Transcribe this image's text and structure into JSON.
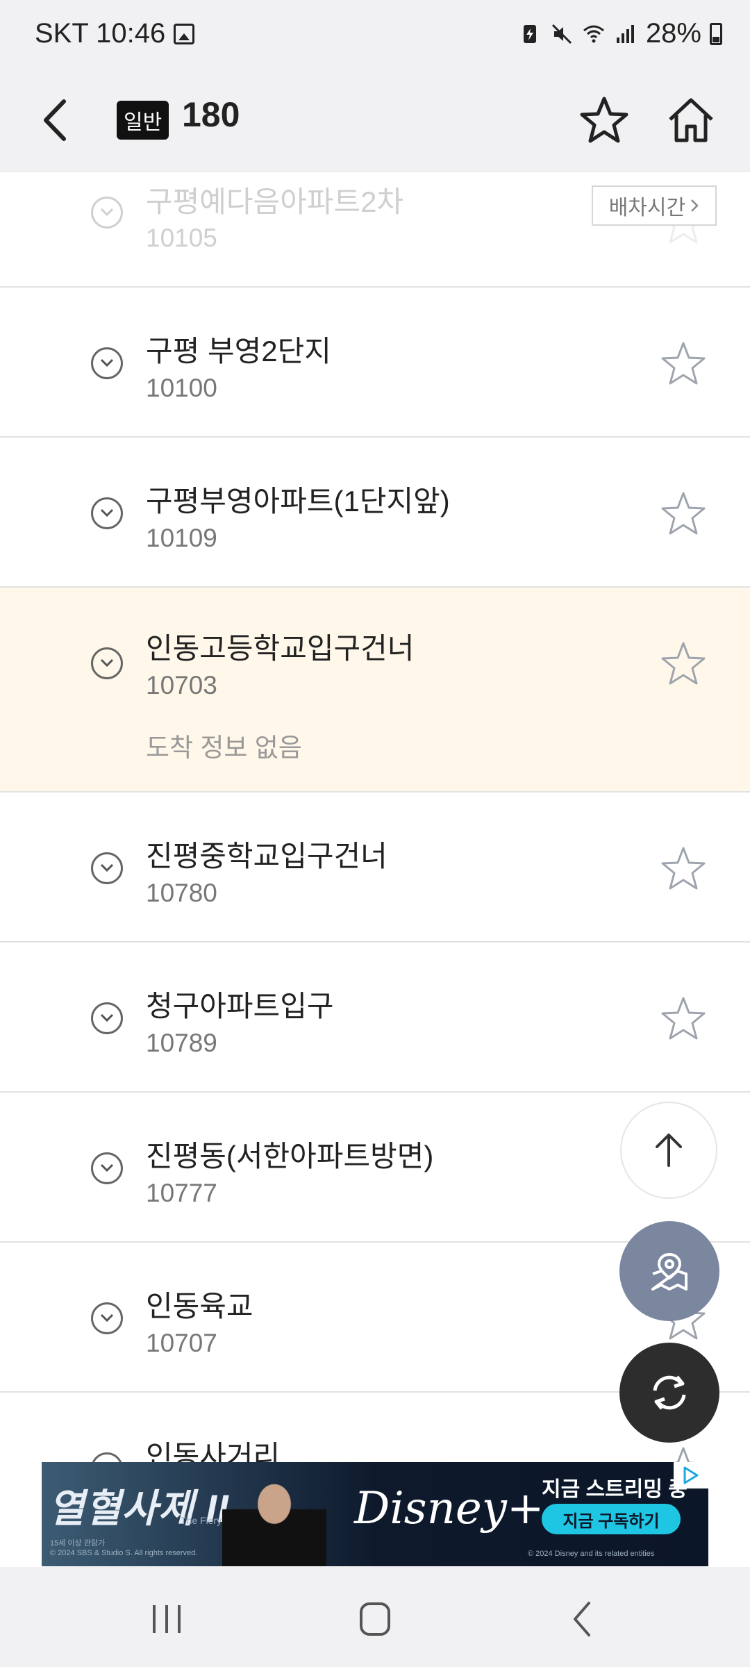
{
  "status_bar": {
    "carrier_time": "SKT 10:46",
    "battery_percent": "28%",
    "icons": [
      "image-icon",
      "battery-saver-icon",
      "mute-icon",
      "wifi-icon",
      "signal-icon",
      "battery-icon"
    ]
  },
  "header": {
    "route_type": "일반",
    "route_number": "180"
  },
  "schedule_button_label": "배차시간",
  "stops": [
    {
      "name": "구평예다음아파트2차",
      "id": "10105"
    },
    {
      "name": "구평 부영2단지",
      "id": "10100"
    },
    {
      "name": "구평부영아파트(1단지앞)",
      "id": "10109"
    },
    {
      "name": "인동고등학교입구건너",
      "id": "10703",
      "arrival": "도착 정보 없음",
      "highlighted": true
    },
    {
      "name": "진평중학교입구건너",
      "id": "10780"
    },
    {
      "name": "청구아파트입구",
      "id": "10789"
    },
    {
      "name": "진평동(서한아파트방면)",
      "id": "10777"
    },
    {
      "name": "인동육교",
      "id": "10707"
    },
    {
      "name": "인동사거리",
      "id": ""
    }
  ],
  "ad": {
    "title": "열혈사제 II",
    "subtitle": "The Fiery Priest",
    "rating": "15세 이상 관람가",
    "copyright_left": "© 2024 SBS & Studio S. All rights reserved.",
    "brand": "Disney+",
    "streaming": "지금 스트리밍 중",
    "cta": "지금 구독하기",
    "copyright_right": "© 2024 Disney and its related entities"
  },
  "colors": {
    "highlight_row": "#fff8ea",
    "route_line": "#9a9a9a",
    "map_fab": "#7b879f",
    "refresh_fab": "#2d2d2d",
    "ad_cta": "#1fc6e3"
  }
}
